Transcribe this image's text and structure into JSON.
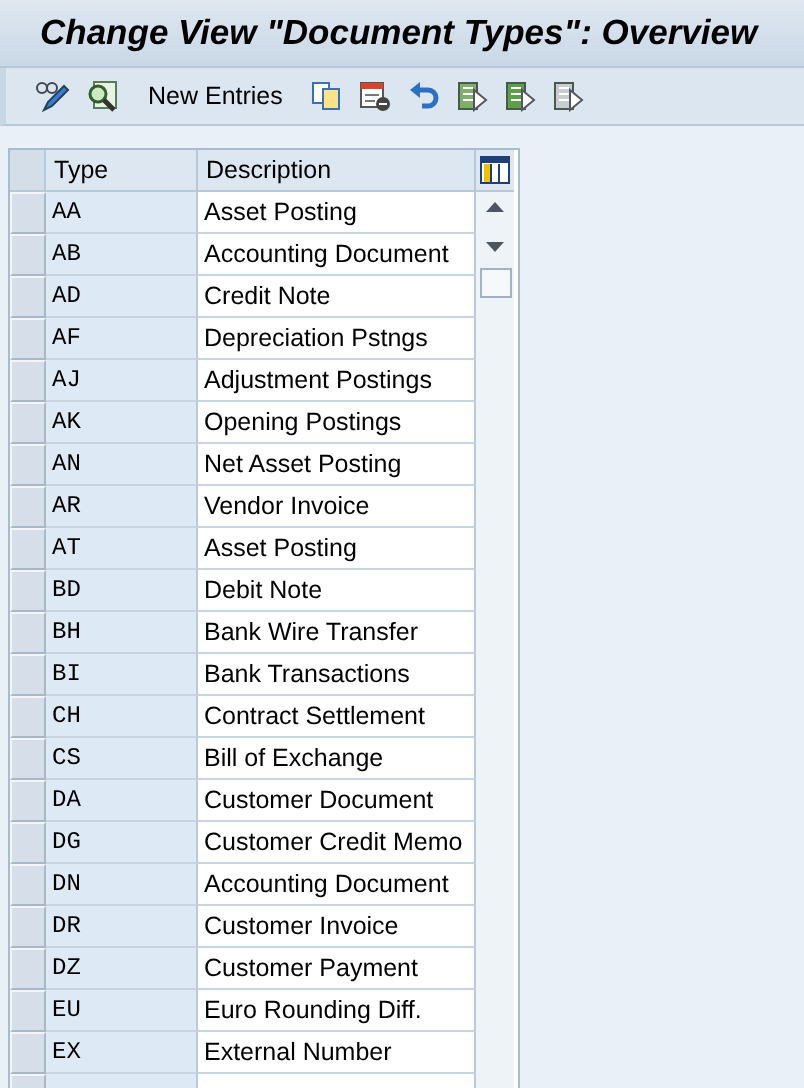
{
  "window": {
    "title": "Change View \"Document Types\": Overview"
  },
  "toolbar": {
    "new_entries": "New Entries"
  },
  "table": {
    "columns": [
      "Type",
      "Description"
    ],
    "rows": [
      {
        "type": "AA",
        "description": "Asset Posting"
      },
      {
        "type": "AB",
        "description": "Accounting Document"
      },
      {
        "type": "AD",
        "description": "Credit Note"
      },
      {
        "type": "AF",
        "description": "Depreciation Pstngs"
      },
      {
        "type": "AJ",
        "description": "Adjustment Postings"
      },
      {
        "type": "AK",
        "description": "Opening Postings"
      },
      {
        "type": "AN",
        "description": "Net Asset Posting"
      },
      {
        "type": "AR",
        "description": "Vendor Invoice"
      },
      {
        "type": "AT",
        "description": "Asset Posting"
      },
      {
        "type": "BD",
        "description": "Debit Note"
      },
      {
        "type": "BH",
        "description": "Bank Wire Transfer"
      },
      {
        "type": "BI",
        "description": "Bank Transactions"
      },
      {
        "type": "CH",
        "description": "Contract Settlement"
      },
      {
        "type": "CS",
        "description": "Bill of Exchange"
      },
      {
        "type": "DA",
        "description": "Customer Document"
      },
      {
        "type": "DG",
        "description": "Customer Credit Memo"
      },
      {
        "type": "DN",
        "description": "Accounting Document"
      },
      {
        "type": "DR",
        "description": "Customer Invoice"
      },
      {
        "type": "DZ",
        "description": "Customer Payment"
      },
      {
        "type": "EU",
        "description": "Euro Rounding Diff."
      },
      {
        "type": "EX",
        "description": "External Number"
      }
    ]
  }
}
